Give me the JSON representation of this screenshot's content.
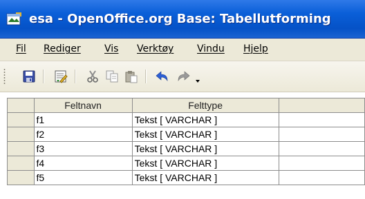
{
  "window": {
    "title": "esa - OpenOffice.org Base: Tabellutforming"
  },
  "menu": [
    {
      "label": "Fil"
    },
    {
      "label": "Rediger"
    },
    {
      "label": "Vis"
    },
    {
      "label": "Verktøy"
    },
    {
      "label": "Vindu"
    },
    {
      "label": "Hjelp"
    }
  ],
  "toolbar": {
    "buttons": [
      {
        "icon": "save-icon"
      },
      {
        "icon": "edit-index-icon"
      },
      {
        "icon": "cut-icon"
      },
      {
        "icon": "copy-icon"
      },
      {
        "icon": "paste-icon"
      },
      {
        "icon": "undo-icon"
      },
      {
        "icon": "redo-icon"
      },
      {
        "icon": "dropdown-arrow-icon"
      }
    ]
  },
  "table": {
    "headers": [
      "Feltnavn",
      "Felttype"
    ],
    "rows": [
      {
        "name": "f1",
        "type": "Tekst [ VARCHAR ]"
      },
      {
        "name": "f2",
        "type": "Tekst [ VARCHAR ]"
      },
      {
        "name": "f3",
        "type": "Tekst [ VARCHAR ]"
      },
      {
        "name": "f4",
        "type": "Tekst [ VARCHAR ]"
      },
      {
        "name": "f5",
        "type": "Tekst [ VARCHAR ]"
      }
    ]
  },
  "colors": {
    "titlebar": "#0a5fd8",
    "chrome": "#ece9d8",
    "undo_arrow": "#2c5fd6",
    "redo_arrow": "#9a9a9a"
  }
}
